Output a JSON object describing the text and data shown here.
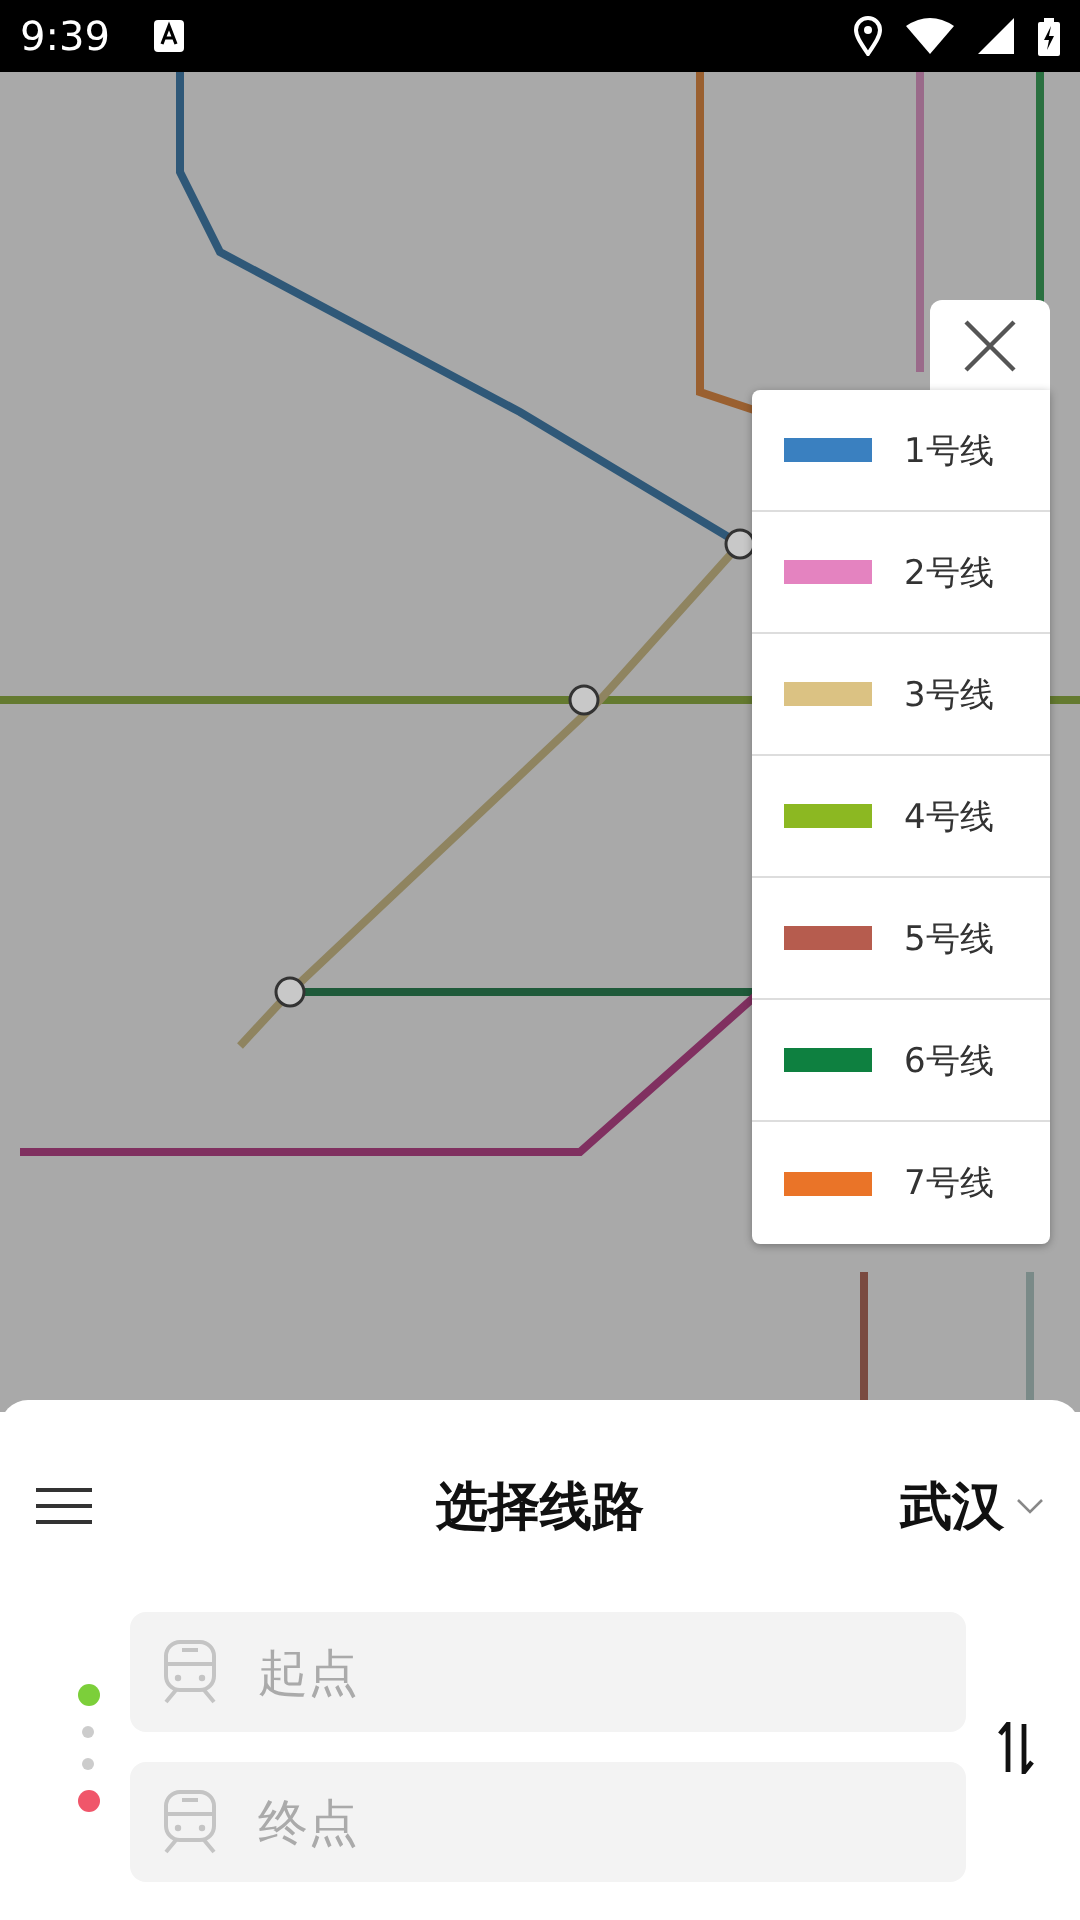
{
  "status_bar": {
    "time": "9:39"
  },
  "line_legend": {
    "items": [
      {
        "label": "1号线",
        "color": "#3a80c0"
      },
      {
        "label": "2号线",
        "color": "#e483c0"
      },
      {
        "label": "3号线",
        "color": "#dbc283"
      },
      {
        "label": "4号线",
        "color": "#8cb822"
      },
      {
        "label": "5号线",
        "color": "#b65c4e"
      },
      {
        "label": "6号线",
        "color": "#0e8040"
      },
      {
        "label": "7号线",
        "color": "#ea7428"
      }
    ]
  },
  "route_panel": {
    "title": "选择线路",
    "city": "武汉",
    "fields": [
      {
        "placeholder": "起点",
        "kind": "start"
      },
      {
        "placeholder": "终点",
        "kind": "end"
      }
    ]
  }
}
